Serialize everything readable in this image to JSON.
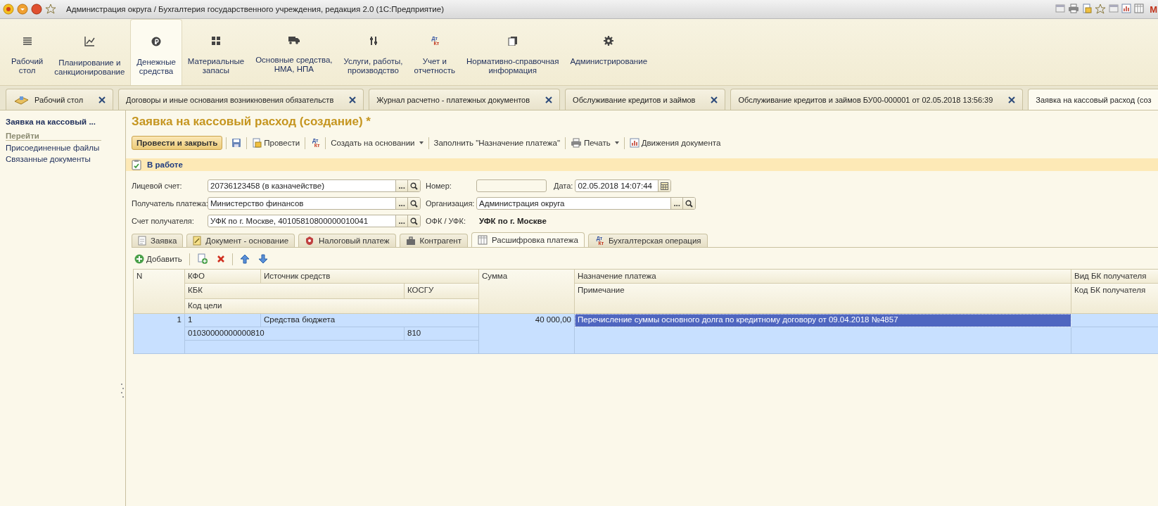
{
  "window": {
    "title": "Администрация округа / Бухгалтерия государственного учреждения, редакция 2.0  (1С:Предприятие)",
    "corner_letter": "М"
  },
  "sections": [
    {
      "label": "Рабочий\nстол",
      "selected": false
    },
    {
      "label": "Планирование и\nсанкционирование",
      "selected": false
    },
    {
      "label": "Денежные\nсредства",
      "selected": true
    },
    {
      "label": "Материальные\nзапасы",
      "selected": false
    },
    {
      "label": "Основные средства,\nНМА, НПА",
      "selected": false
    },
    {
      "label": "Услуги, работы,\nпроизводство",
      "selected": false
    },
    {
      "label": "Учет и\nотчетность",
      "selected": false,
      "icon_letters": [
        "Дт",
        "Кт"
      ]
    },
    {
      "label": "Нормативно-справочная\nинформация",
      "selected": false
    },
    {
      "label": "Администрирование",
      "selected": false
    }
  ],
  "open_tabs": [
    {
      "kind": "home",
      "label": "Рабочий стол",
      "selected": false,
      "closable": true
    },
    {
      "kind": "page",
      "label": "Договоры и иные основания возникновения обязательств",
      "selected": false,
      "closable": true
    },
    {
      "kind": "page",
      "label": "Журнал расчетно - платежных документов",
      "selected": false,
      "closable": true
    },
    {
      "kind": "page",
      "label": "Обслуживание кредитов и займов",
      "selected": false,
      "closable": true
    },
    {
      "kind": "page",
      "label": "Обслуживание кредитов и займов БУ00-000001 от 02.05.2018 13:56:39",
      "selected": false,
      "closable": true
    },
    {
      "kind": "page",
      "label": "Заявка на кассовый расход (соз",
      "selected": true,
      "closable": false
    }
  ],
  "sidebar": {
    "title": "Заявка на кассовый ...",
    "group": "Перейти",
    "links": [
      "Присоединенные файлы",
      "Связанные документы"
    ]
  },
  "form": {
    "title": "Заявка на кассовый расход (создание) *",
    "toolbar": [
      {
        "kind": "primary",
        "label": "Провести и закрыть"
      },
      {
        "kind": "save"
      },
      {
        "kind": "post",
        "label": "Провести"
      },
      {
        "kind": "ledger",
        "icon_letters": [
          "Дт",
          "Кт"
        ]
      },
      {
        "kind": "plain",
        "label": "Создать на основании",
        "dropdown": true
      },
      {
        "kind": "plain",
        "label": "Заполнить \"Назначение платежа\"",
        "dropdown": false
      },
      {
        "kind": "print",
        "label": "Печать",
        "dropdown": true
      },
      {
        "kind": "movements",
        "label": "Движения документа"
      }
    ],
    "status": {
      "label": "В работе"
    },
    "fields": [
      [
        {
          "label": "Лицевой счет:",
          "kind": "lookup",
          "value": "20736123458 (в казначействе)",
          "choose_button": "..."
        },
        {
          "label": "Номер:",
          "kind": "text"
        },
        {
          "label": "Дата:",
          "kind": "date",
          "value": "02.05.2018 14:07:44"
        }
      ],
      [
        {
          "label": "Получатель платежа:",
          "kind": "lookup",
          "value": "Министерство финансов",
          "choose_button": "..."
        },
        {
          "label": "Организация:",
          "kind": "lookup",
          "value": "Администрация округа",
          "choose_button": "..."
        }
      ],
      [
        {
          "label": "Счет получателя:",
          "kind": "lookup",
          "value": "УФК по г. Москве, 40105810800000010041",
          "choose_button": "..."
        },
        {
          "label": "ОФК / УФК:",
          "kind": "info",
          "value": "УФК по г. Москве"
        }
      ]
    ],
    "tabs": [
      {
        "label": "Заявка",
        "selected": false
      },
      {
        "label": "Документ - основание",
        "selected": false
      },
      {
        "label": "Налоговый платеж",
        "selected": false
      },
      {
        "label": "Контрагент",
        "selected": false
      },
      {
        "label": "Расшифровка платежа",
        "selected": true
      },
      {
        "label": "Бухгалтерская операция",
        "selected": false,
        "icon_letters": [
          "Дт",
          "Кт"
        ]
      }
    ],
    "table_toolbar": [
      {
        "kind": "add",
        "label": "Добавить"
      },
      {
        "kind": "copy"
      },
      {
        "kind": "delete"
      },
      {
        "kind": "up"
      },
      {
        "kind": "down"
      }
    ],
    "table": {
      "columns": [
        "N",
        "КФО",
        "Источник средств",
        "КБК",
        "КОСГУ",
        "Код цели",
        "Сумма",
        "Назначение платежа",
        "Примечание",
        "Вид БК получателя",
        "Код БК получателя"
      ],
      "rows": [
        {
          "selected": true,
          "cells": [
            {
              "text": "1",
              "focused": false
            },
            {
              "text": "1",
              "focused": false
            },
            {
              "text": "Средства бюджета",
              "focused": false
            },
            {
              "text": "01030000000000810",
              "focused": false
            },
            {
              "text": "810",
              "focused": false
            },
            {
              "focused": false
            },
            {
              "text": "40 000,00",
              "focused": false
            },
            {
              "text": "Перечисление суммы основного долга по кредитному договору от 09.04.2018 №4857",
              "focused": true
            },
            {
              "focused": false
            },
            {
              "focused": false
            },
            {
              "focused": false
            }
          ]
        }
      ]
    }
  }
}
